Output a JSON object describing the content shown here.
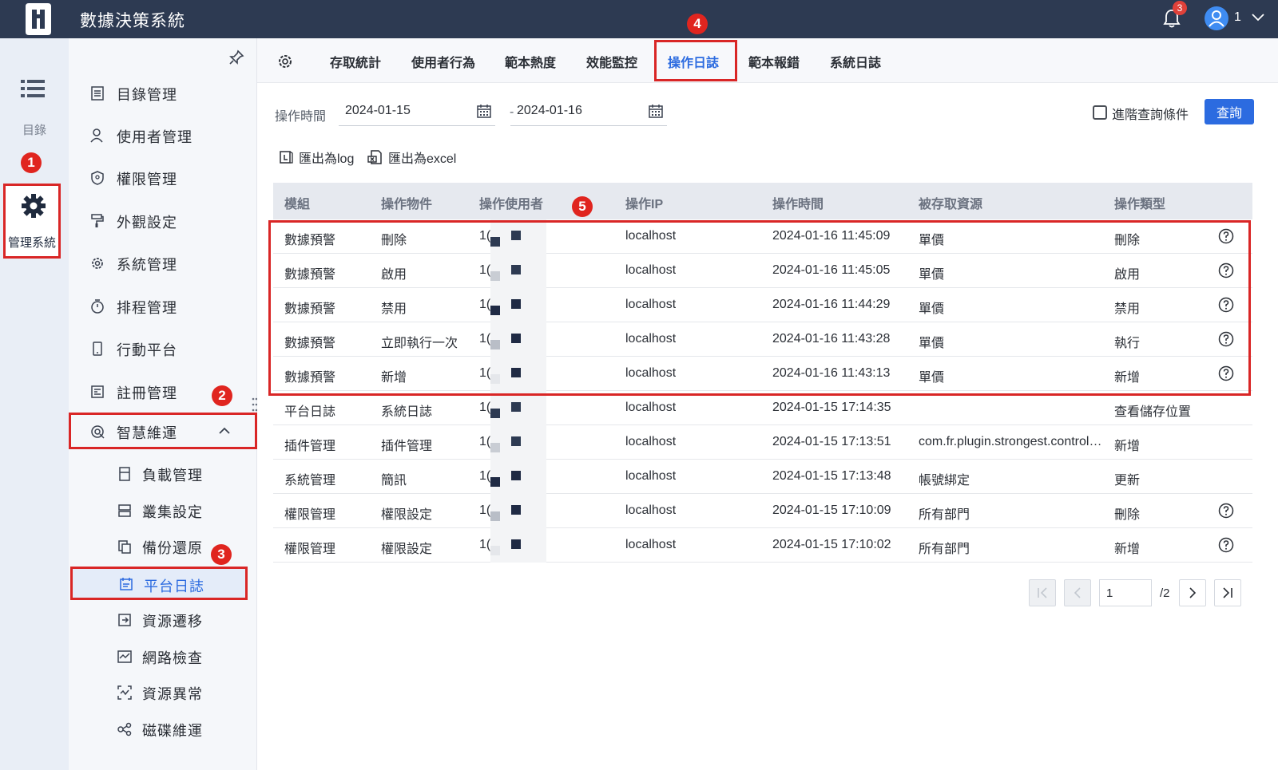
{
  "app": {
    "title": "數據決策系統",
    "notification_count": "3",
    "user_name": "1"
  },
  "rail": {
    "catalog_label": "目錄",
    "admin_label": "管理系統"
  },
  "markers": [
    "1",
    "2",
    "3",
    "4",
    "5"
  ],
  "sidebar": {
    "items": [
      {
        "label": "目錄管理",
        "icon": "list-doc-icon"
      },
      {
        "label": "使用者管理",
        "icon": "user-icon"
      },
      {
        "label": "權限管理",
        "icon": "shield-icon"
      },
      {
        "label": "外觀設定",
        "icon": "paint-roller-icon"
      },
      {
        "label": "系統管理",
        "icon": "gear-icon"
      },
      {
        "label": "排程管理",
        "icon": "timer-icon"
      },
      {
        "label": "行動平台",
        "icon": "phone-icon"
      },
      {
        "label": "註冊管理",
        "icon": "register-icon"
      },
      {
        "label": "智慧維運",
        "icon": "smart-ops-icon",
        "expanded": true
      }
    ],
    "subitems": [
      {
        "label": "負載管理",
        "icon": "load-icon"
      },
      {
        "label": "叢集設定",
        "icon": "cluster-icon"
      },
      {
        "label": "備份還原",
        "icon": "backup-icon"
      },
      {
        "label": "平台日誌",
        "icon": "log-icon",
        "active": true
      },
      {
        "label": "資源遷移",
        "icon": "migrate-icon"
      },
      {
        "label": "網路檢查",
        "icon": "network-icon"
      },
      {
        "label": "資源異常",
        "icon": "anomaly-icon"
      },
      {
        "label": "磁碟維運",
        "icon": "disk-icon"
      }
    ]
  },
  "tabs": [
    {
      "label": "存取統計"
    },
    {
      "label": "使用者行為"
    },
    {
      "label": "範本熱度"
    },
    {
      "label": "效能監控"
    },
    {
      "label": "操作日誌",
      "active": true
    },
    {
      "label": "範本報錯"
    },
    {
      "label": "系統日誌"
    }
  ],
  "filters": {
    "time_label": "操作時間",
    "start_date": "2024-01-15",
    "separator": "-",
    "end_date": "2024-01-16",
    "advanced_label": "進階查詢條件",
    "query_button": "查詢"
  },
  "export": {
    "log_label": "匯出為log",
    "excel_label": "匯出為excel"
  },
  "table": {
    "columns": [
      "模組",
      "操作物件",
      "操作使用者",
      "操作IP",
      "操作時間",
      "被存取資源",
      "操作類型"
    ],
    "rows": [
      {
        "module": "數據預警",
        "object": "刪除",
        "user": "1(",
        "ip": "localhost",
        "time": "2024-01-16 11:45:09",
        "resource": "單價",
        "type": "刪除",
        "help": true
      },
      {
        "module": "數據預警",
        "object": "啟用",
        "user": "1(",
        "ip": "localhost",
        "time": "2024-01-16 11:45:05",
        "resource": "單價",
        "type": "啟用",
        "help": true
      },
      {
        "module": "數據預警",
        "object": "禁用",
        "user": "1(",
        "ip": "localhost",
        "time": "2024-01-16 11:44:29",
        "resource": "單價",
        "type": "禁用",
        "help": true
      },
      {
        "module": "數據預警",
        "object": "立即執行一次",
        "user": "1(",
        "ip": "localhost",
        "time": "2024-01-16 11:43:28",
        "resource": "單價",
        "type": "執行",
        "help": true
      },
      {
        "module": "數據預警",
        "object": "新增",
        "user": "1(",
        "ip": "localhost",
        "time": "2024-01-16 11:43:13",
        "resource": "單價",
        "type": "新增",
        "help": true
      },
      {
        "module": "平台日誌",
        "object": "系統日誌",
        "user": "1(",
        "ip": "localhost",
        "time": "2024-01-15 17:14:35",
        "resource": "",
        "type": "查看儲存位置",
        "help": false
      },
      {
        "module": "插件管理",
        "object": "插件管理",
        "user": "1(",
        "ip": "localhost",
        "time": "2024-01-15 17:13:51",
        "resource": "com.fr.plugin.strongest.control…",
        "type": "新增",
        "help": false
      },
      {
        "module": "系統管理",
        "object": "簡訊",
        "user": "1(",
        "ip": "localhost",
        "time": "2024-01-15 17:13:48",
        "resource": "帳號綁定",
        "type": "更新",
        "help": false
      },
      {
        "module": "權限管理",
        "object": "權限設定",
        "user": "1(",
        "ip": "localhost",
        "time": "2024-01-15 17:10:09",
        "resource": "所有部門",
        "type": "刪除",
        "help": true
      },
      {
        "module": "權限管理",
        "object": "權限設定",
        "user": "1(",
        "ip": "localhost",
        "time": "2024-01-15 17:10:02",
        "resource": "所有部門",
        "type": "新增",
        "help": true
      }
    ]
  },
  "pagination": {
    "current_page": "1",
    "total": "/2"
  },
  "colors": {
    "accent": "#2c6be0",
    "topbar": "#2d3a52",
    "highlight": "#d92626"
  }
}
